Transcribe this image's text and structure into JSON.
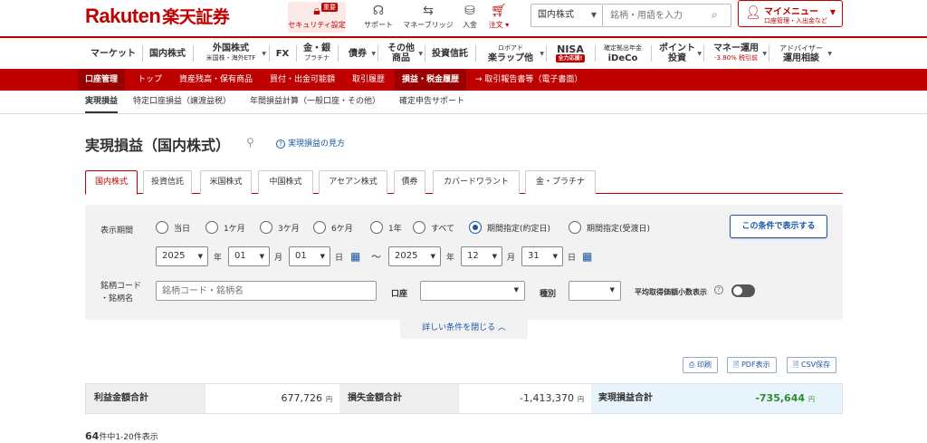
{
  "header": {
    "logo_en": "Rakuten",
    "logo_jp": "楽天証券",
    "icons": [
      {
        "name": "lock-icon",
        "label": "セキュリティ設定",
        "badge": "重要"
      },
      {
        "name": "headset-icon",
        "label": "サポート"
      },
      {
        "name": "bridge-icon",
        "label": "マネーブリッジ"
      },
      {
        "name": "coin-icon",
        "label": "入金"
      },
      {
        "name": "cart-icon",
        "label": "注文 ▾"
      }
    ],
    "market_select": "国内株式",
    "search_placeholder": "銘柄・用語を入力",
    "mymenu_title": "マイメニュー",
    "mymenu_sub": "口座管理・入出金など"
  },
  "gnav": {
    "items": [
      {
        "label": "マーケット",
        "sub": ""
      },
      {
        "label": "国内株式",
        "sub": ""
      },
      {
        "label": "外国株式",
        "sub": "米国株・海外ETF"
      },
      {
        "label": "FX",
        "sub": ""
      },
      {
        "label": "金・銀",
        "sub": "プラチナ"
      },
      {
        "label": "債券",
        "sub": ""
      },
      {
        "label": "その他",
        "sub": "商品"
      },
      {
        "label": "投資信託",
        "sub": ""
      },
      {
        "label": "ロボアド",
        "sub": "楽ラップ他"
      },
      {
        "label": "NISA",
        "sub": "全力応援!"
      },
      {
        "label": "確定拠出年金",
        "sub": "iDeCo"
      },
      {
        "label": "ポイント",
        "sub": "投資"
      },
      {
        "label": "マネー運用",
        "sub": "-3.80% 税引前"
      },
      {
        "label": "アドバイザー",
        "sub": "運用相談"
      }
    ]
  },
  "subnav": {
    "account": "口座管理",
    "items": [
      "トップ",
      "資産残高・保有商品",
      "買付・出金可能額",
      "取引履歴",
      "損益・税金履歴",
      "→ 取引報告書等（電子書面）"
    ]
  },
  "subsubnav": {
    "items": [
      "実現損益",
      "特定口座損益（譲渡益税）",
      "年間損益計算（一般口座・その他）",
      "確定申告サポート"
    ]
  },
  "page": {
    "title": "実現損益（国内株式）",
    "help": "実現損益の見方"
  },
  "tabs": [
    "国内株式",
    "投資信託",
    "米国株式",
    "中国株式",
    "アセアン株式",
    "債券",
    "カバードワラント",
    "金・プラチナ"
  ],
  "filter": {
    "period_label": "表示期間",
    "radios": [
      "当日",
      "1ケ月",
      "3ケ月",
      "6ケ月",
      "1年",
      "すべて",
      "期間指定(約定日)",
      "期間指定(受渡日)"
    ],
    "selected_radio": 6,
    "apply": "この条件で表示する",
    "from": {
      "year": "2025",
      "month": "01",
      "day": "01"
    },
    "to": {
      "year": "2025",
      "month": "12",
      "day": "31"
    },
    "units": {
      "year": "年",
      "month": "月",
      "day": "日",
      "tilde": "～"
    },
    "code_label_1": "銘柄コード",
    "code_label_2": "・銘柄名",
    "code_placeholder": "銘柄コード・銘柄名",
    "account_label": "口座",
    "type_label": "種別",
    "avg_label": "平均取得価額小数表示",
    "collapse": "詳しい条件を閉じる ︿"
  },
  "actions": {
    "print": "印刷",
    "pdf": "PDF表示",
    "csv": "CSV保存"
  },
  "summary": {
    "profit_label": "利益金額合計",
    "profit_value": "677,726",
    "loss_label": "損失金額合計",
    "loss_value": "-1,413,370",
    "net_label": "実現損益合計",
    "net_value": "-735,644",
    "yen": "円"
  },
  "count": {
    "total": "64",
    "text": "件中1-20件表示"
  },
  "colors": {
    "brand": "#bf0000",
    "link": "#1a56a6",
    "negative": "#2e8b2e"
  }
}
